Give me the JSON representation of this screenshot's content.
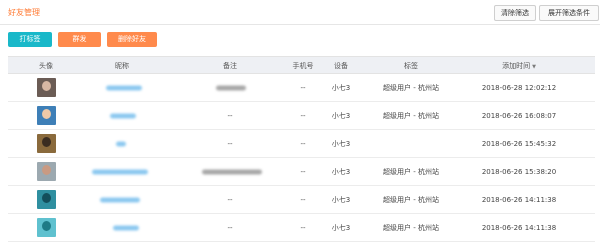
{
  "header": {
    "title": "好友管理",
    "clear_filter_label": "清除筛选",
    "expand_filter_label": "展开筛选条件"
  },
  "toolbar": {
    "tag_label": "打标签",
    "group_send_label": "群发",
    "delete_friend_label": "删除好友"
  },
  "colors": {
    "accent_orange": "#ff8a4c",
    "accent_teal": "#19b8c9",
    "nickname_link": "#7fc2ee"
  },
  "table": {
    "columns": [
      "头像",
      "昵称",
      "备注",
      "手机号",
      "设备",
      "标签",
      "添加时间"
    ],
    "sort_indicator": "▼",
    "rows": [
      {
        "remark": "",
        "phone": "--",
        "device": "小七3",
        "tags": "超级用户 - 杭州站",
        "added_at": "2018-06-28 12:02:12"
      },
      {
        "remark": "--",
        "phone": "--",
        "device": "小七3",
        "tags": "超级用户 - 杭州站",
        "added_at": "2018-06-26 16:08:07"
      },
      {
        "remark": "--",
        "phone": "--",
        "device": "小七3",
        "tags": "",
        "added_at": "2018-06-26 15:45:32"
      },
      {
        "remark": "",
        "phone": "--",
        "device": "小七3",
        "tags": "超级用户 - 杭州站",
        "added_at": "2018-06-26 15:38:20"
      },
      {
        "remark": "--",
        "phone": "--",
        "device": "小七3",
        "tags": "超级用户 - 杭州站",
        "added_at": "2018-06-26 14:11:38"
      },
      {
        "remark": "--",
        "phone": "--",
        "device": "小七3",
        "tags": "超级用户 - 杭州站",
        "added_at": "2018-06-26 14:11:38"
      }
    ]
  }
}
